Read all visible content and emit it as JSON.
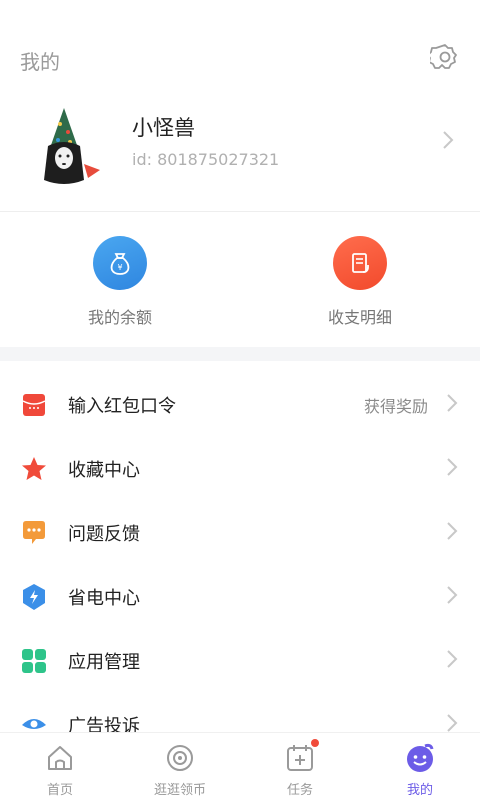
{
  "header": {
    "title": "我的",
    "settings_icon": "gear-icon"
  },
  "profile": {
    "name": "小怪兽",
    "id_text": "id: 801875027321"
  },
  "wallet": [
    {
      "label": "我的余额",
      "icon": "money-bag-icon",
      "color": "#3b95e8"
    },
    {
      "label": "收支明细",
      "icon": "receipt-icon",
      "color": "#f5563a"
    }
  ],
  "menu": [
    {
      "label": "输入红包口令",
      "extra": "获得奖励",
      "icon": "red-envelope-icon"
    },
    {
      "label": "收藏中心",
      "extra": "",
      "icon": "star-icon"
    },
    {
      "label": "问题反馈",
      "extra": "",
      "icon": "chat-bubble-icon"
    },
    {
      "label": "省电中心",
      "extra": "",
      "icon": "lightning-shield-icon"
    },
    {
      "label": "应用管理",
      "extra": "",
      "icon": "apps-grid-icon"
    },
    {
      "label": "广告投诉",
      "extra": "",
      "icon": "eye-icon"
    }
  ],
  "tabs": [
    {
      "label": "首页",
      "icon": "home-icon"
    },
    {
      "label": "逛逛领币",
      "icon": "eye-coin-icon"
    },
    {
      "label": "任务",
      "icon": "task-icon",
      "badge": true
    },
    {
      "label": "我的",
      "icon": "smiley-icon",
      "active": true
    }
  ],
  "colors": {
    "accent": "#6c5ce7",
    "badge": "#f04b3a",
    "divider": "#f4f5f7"
  }
}
